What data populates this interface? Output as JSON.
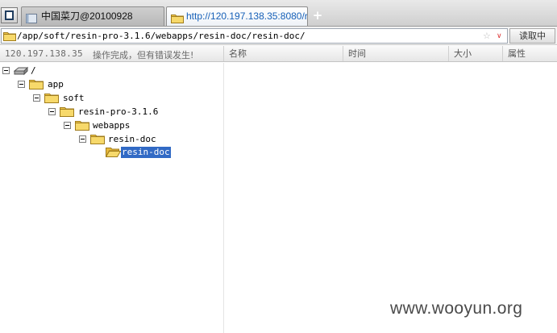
{
  "tabs": [
    {
      "label": "中国菜刀@20100928",
      "active": false
    },
    {
      "label": "http://120.197.138.35:8080/r...",
      "active": true
    }
  ],
  "new_tab_label": "+",
  "address": {
    "value": "/app/soft/resin-pro-3.1.6/webapps/resin-doc/resin-doc/",
    "star_glyph": "☆",
    "dropdown_glyph": "∨",
    "read_button": "读取中"
  },
  "status": {
    "ip": "120.197.138.35",
    "message": "操作完成，但有错误发生!"
  },
  "columns": [
    "名称",
    "时间",
    "大小",
    "属性"
  ],
  "tree": [
    {
      "label": "/",
      "icon": "drive-icon",
      "selected": false
    },
    {
      "label": "app",
      "icon": "folder-icon",
      "selected": false
    },
    {
      "label": "soft",
      "icon": "folder-icon",
      "selected": false
    },
    {
      "label": "resin-pro-3.1.6",
      "icon": "folder-icon",
      "selected": false
    },
    {
      "label": "webapps",
      "icon": "folder-icon",
      "selected": false
    },
    {
      "label": "resin-doc",
      "icon": "folder-icon",
      "selected": false
    },
    {
      "label": "resin-doc",
      "icon": "open-folder-icon",
      "selected": true
    }
  ],
  "watermark": "www.wooyun.org",
  "colors": {
    "accent_link": "#1760b8",
    "selection": "#316ac5",
    "folder": "#f2c94c"
  }
}
